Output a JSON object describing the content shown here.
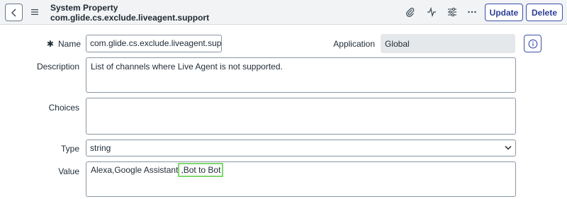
{
  "header": {
    "title": "System Property",
    "subtitle": "com.glide.cs.exclude.liveagent.support",
    "update_label": "Update",
    "delete_label": "Delete"
  },
  "form": {
    "name": {
      "required_mark": "✱",
      "label": "Name",
      "value": "com.glide.cs.exclude.liveagent.support"
    },
    "application": {
      "label": "Application",
      "value": "Global"
    },
    "description": {
      "label": "Description",
      "value": "List of channels where Live Agent is not supported."
    },
    "choices": {
      "label": "Choices",
      "value": ""
    },
    "type": {
      "label": "Type",
      "value": "string"
    },
    "value": {
      "label": "Value",
      "text_before": "Alexa,Google Assistant",
      "text_highlighted": ",Bot to Bot"
    }
  },
  "colors": {
    "accent": "#3d50a8",
    "highlight": "#7fd66f",
    "readonly_bg": "#e5e8eb"
  }
}
